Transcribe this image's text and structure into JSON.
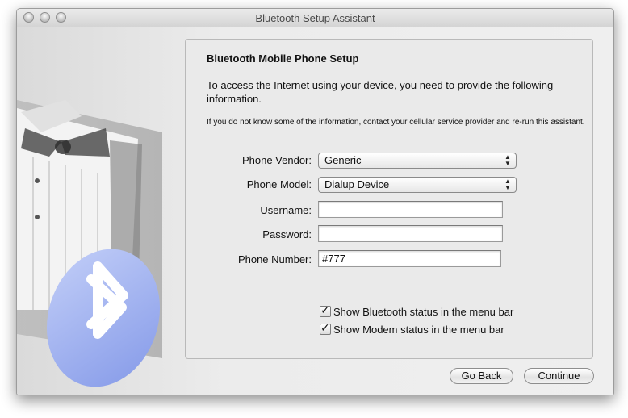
{
  "window": {
    "title": "Bluetooth Setup Assistant"
  },
  "panel": {
    "heading": "Bluetooth Mobile Phone Setup",
    "intro": "To access the Internet using your device, you need to provide the following information.",
    "note": "If you do not know some of the information, contact your cellular service provider and re-run this assistant."
  },
  "form": {
    "vendor_label": "Phone Vendor:",
    "vendor_value": "Generic",
    "model_label": "Phone Model:",
    "model_value": "Dialup Device",
    "username_label": "Username:",
    "username_value": "",
    "password_label": "Password:",
    "password_value": "",
    "number_label": "Phone Number:",
    "number_value": "#777"
  },
  "options": {
    "bluetooth_status": {
      "label": "Show Bluetooth status in the menu bar",
      "checked": true
    },
    "modem_status": {
      "label": "Show Modem status in the menu bar",
      "checked": true
    }
  },
  "buttons": {
    "back": "Go Back",
    "continue": "Continue"
  },
  "icons": {
    "art": "bluetooth-tuxedo-icon",
    "checkmark": "checkmark-icon"
  },
  "colors": {
    "bluetooth_blue": "#9aaef0",
    "window_bg": "#e8e8e8"
  }
}
